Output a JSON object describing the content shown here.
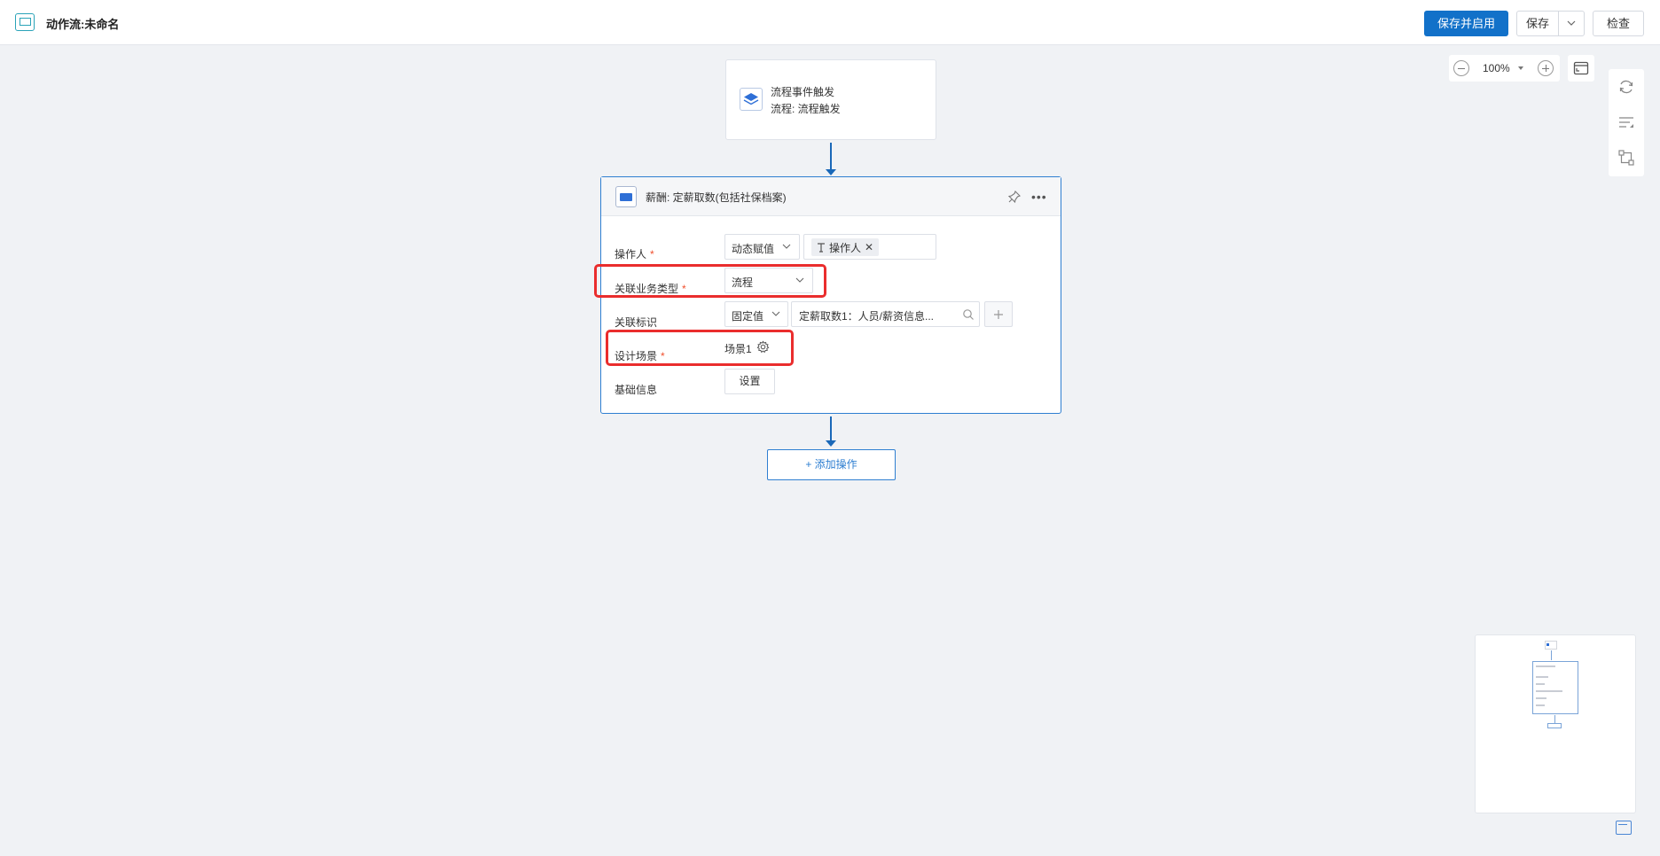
{
  "header": {
    "title": "动作流:未命名",
    "save_enable_label": "保存并启用",
    "save_label": "保存",
    "check_label": "检查"
  },
  "zoom": {
    "level": "100%"
  },
  "trigger_node": {
    "line1": "流程事件触发",
    "line2": "流程: 流程触发"
  },
  "action_node": {
    "title": "薪酬: 定薪取数(包括社保档案)",
    "fields": {
      "operator": {
        "label": "操作人",
        "mode": "动态赋值",
        "tag": "操作人"
      },
      "biz_type": {
        "label": "关联业务类型",
        "value": "流程"
      },
      "link_id": {
        "label": "关联标识",
        "mode": "固定值",
        "value": "定薪取数1：人员/薪资信息..."
      },
      "scene": {
        "label": "设计场景",
        "value": "场景1"
      },
      "basic_info": {
        "label": "基础信息",
        "button": "设置"
      }
    }
  },
  "add_operation_label": "+ 添加操作",
  "colors": {
    "primary": "#1271c9",
    "node_border": "#2f7fd1",
    "connector": "#1a68b8",
    "required": "#f0502e",
    "highlight": "#ea2d2d"
  }
}
